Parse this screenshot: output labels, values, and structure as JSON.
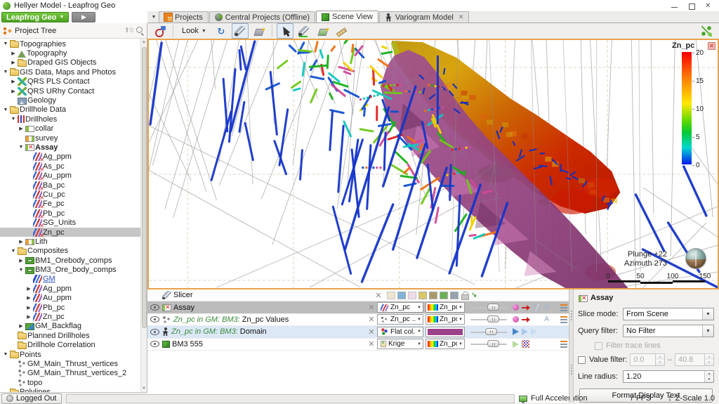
{
  "window": {
    "title": "Hellyer Model - Leapfrog Geo"
  },
  "app_menu": {
    "label": "Leapfrog Geo"
  },
  "tab_bar": {
    "tabs": [
      {
        "label": "Projects",
        "icon": "projects-icon",
        "active": false,
        "closable": false
      },
      {
        "label": "Central Projects (Offline)",
        "icon": "central-projects-icon",
        "active": false,
        "closable": false
      },
      {
        "label": "Scene View",
        "icon": "scene-cube-icon",
        "active": true,
        "closable": false
      },
      {
        "label": "Variogram Model",
        "icon": "variogram-person-icon",
        "active": false,
        "closable": true
      }
    ]
  },
  "project_tree": {
    "title": "Project Tree",
    "up_count": "0",
    "items": [
      {
        "label": "Topographies",
        "level": 0,
        "arrow": "down",
        "icon": "folder"
      },
      {
        "label": "Topography",
        "level": 1,
        "arrow": "right",
        "icon": "topo"
      },
      {
        "label": "Draped GIS Objects",
        "level": 1,
        "arrow": "right",
        "icon": "folder"
      },
      {
        "label": "GIS Data, Maps and Photos",
        "level": 0,
        "arrow": "down",
        "icon": "folder"
      },
      {
        "label": "QRS PLS Contact",
        "level": 1,
        "arrow": "right",
        "icon": "contact"
      },
      {
        "label": "QRS URhy Contact",
        "level": 1,
        "arrow": "right",
        "icon": "contact"
      },
      {
        "label": "Geology",
        "level": 1,
        "arrow": "none",
        "icon": "image"
      },
      {
        "label": "Drillhole Data",
        "level": 0,
        "arrow": "down",
        "icon": "folder"
      },
      {
        "label": "Drillholes",
        "level": 1,
        "arrow": "down",
        "icon": "drill"
      },
      {
        "label": "collar",
        "level": 2,
        "arrow": "right",
        "icon": "table-green"
      },
      {
        "label": "survey",
        "level": 2,
        "arrow": "none",
        "icon": "table-orange"
      },
      {
        "label": "Assay",
        "level": 2,
        "arrow": "down",
        "icon": "table-x",
        "bold": true
      },
      {
        "label": "Ag_ppm",
        "level": 3,
        "arrow": "none",
        "icon": "numeric"
      },
      {
        "label": "As_pc",
        "level": 3,
        "arrow": "none",
        "icon": "numeric"
      },
      {
        "label": "Au_ppm",
        "level": 3,
        "arrow": "none",
        "icon": "numeric"
      },
      {
        "label": "Ba_pc",
        "level": 3,
        "arrow": "none",
        "icon": "numeric"
      },
      {
        "label": "Cu_pc",
        "level": 3,
        "arrow": "none",
        "icon": "numeric"
      },
      {
        "label": "Fe_pc",
        "level": 3,
        "arrow": "none",
        "icon": "numeric"
      },
      {
        "label": "Pb_pc",
        "level": 3,
        "arrow": "none",
        "icon": "numeric"
      },
      {
        "label": "SG_Units",
        "level": 3,
        "arrow": "none",
        "icon": "numeric"
      },
      {
        "label": "Zn_pc",
        "level": 3,
        "arrow": "none",
        "icon": "numeric",
        "selected": true
      },
      {
        "label": "Lith",
        "level": 2,
        "arrow": "right",
        "icon": "table-orange"
      },
      {
        "label": "Composites",
        "level": 1,
        "arrow": "down",
        "icon": "folder"
      },
      {
        "label": "BM1_Orebody_comps",
        "level": 2,
        "arrow": "right",
        "icon": "comp"
      },
      {
        "label": "BM3_Ore_body_comps",
        "level": 2,
        "arrow": "down",
        "icon": "comp"
      },
      {
        "label": "GM",
        "level": 3,
        "arrow": "none",
        "icon": "gm",
        "link": true
      },
      {
        "label": "Ag_ppm",
        "level": 3,
        "arrow": "right",
        "icon": "numeric2"
      },
      {
        "label": "Au_ppm",
        "level": 3,
        "arrow": "right",
        "icon": "numeric2"
      },
      {
        "label": "Pb_pc",
        "level": 3,
        "arrow": "right",
        "icon": "numeric2"
      },
      {
        "label": "Zn_pc",
        "level": 3,
        "arrow": "right",
        "icon": "numeric2"
      },
      {
        "label": "GM_Backflag",
        "level": 2,
        "arrow": "right",
        "icon": "backflag"
      },
      {
        "label": "Planned Drillholes",
        "level": 1,
        "arrow": "none",
        "icon": "folder"
      },
      {
        "label": "Drillhole Correlation",
        "level": 1,
        "arrow": "none",
        "icon": "folder"
      },
      {
        "label": "Points",
        "level": 0,
        "arrow": "down",
        "icon": "folder"
      },
      {
        "label": "GM_Main_Thrust_vertices",
        "level": 1,
        "arrow": "none",
        "icon": "points"
      },
      {
        "label": "GM_Main_Thrust_vertices_2",
        "level": 1,
        "arrow": "none",
        "icon": "points"
      },
      {
        "label": "topo",
        "level": 1,
        "arrow": "none",
        "icon": "points"
      },
      {
        "label": "Polylines",
        "level": 0,
        "arrow": "none",
        "icon": "folder"
      }
    ]
  },
  "toolbar": {
    "look_label": "Look"
  },
  "scene": {
    "legend": {
      "title": "Zn_pc",
      "ticks": [
        "20",
        "15",
        "10",
        "5",
        "0"
      ],
      "top_color": "#f80000",
      "bottom_color": "#0018f0"
    },
    "orientation": {
      "plunge": "Plunge +22",
      "azimuth": "Azimuth 273"
    },
    "scale_bar": {
      "labels": [
        "0",
        "50",
        "100",
        "150"
      ]
    }
  },
  "shape_list": {
    "slicer_row": {
      "label": "Slicer"
    },
    "rows": [
      {
        "label": "Assay",
        "icon": "table-x",
        "selected": true,
        "highlight": false,
        "prefix": "",
        "dd1": {
          "icon": "numeric2",
          "label": "Zn_pc"
        },
        "dd2": {
          "type": "colormap",
          "label": "Zn_pc"
        },
        "slider": 72,
        "icons": [
          "sphere-magenta",
          "red-arrow",
          "trace-gray",
          "letter-a"
        ],
        "format_icon": true
      },
      {
        "label": "Zn_pc Values",
        "icon": "points",
        "selected": false,
        "highlight": false,
        "prefix": "Zn_pc in GM: BM3:",
        "dd1": {
          "icon": "points",
          "label": "Zn_pc ..."
        },
        "dd2": {
          "type": "colormap",
          "label": "Zn_pc"
        },
        "slider": 72,
        "icons": [
          "sphere-magenta",
          "red-arrow",
          "empty",
          "letter-a"
        ],
        "format_icon": true
      },
      {
        "label": "Domain",
        "icon": "person",
        "selected": false,
        "highlight": true,
        "prefix": "Zn_pc in GM: BM3:",
        "dd1": {
          "icon": "flat-colour",
          "label": "Flat col..."
        },
        "dd2": {
          "type": "swatch",
          "color": "#9c4189"
        },
        "slider": 62,
        "icons": [
          "cone-blue",
          "cone-light",
          "cone-light2"
        ],
        "format_icon": false
      },
      {
        "label": "BM3 555",
        "icon": "cube",
        "selected": false,
        "highlight": false,
        "prefix": "",
        "dd1": {
          "icon": "krige",
          "label": "Krige"
        },
        "dd2": {
          "type": "colormap",
          "label": "Zn_pc"
        },
        "slider": 72,
        "icons": [
          "cone-green",
          "grid-dots"
        ],
        "format_icon": true
      }
    ]
  },
  "properties": {
    "title": "Assay",
    "slice_mode_label": "Slice mode:",
    "slice_mode": "From Scene",
    "query_filter_label": "Query filter:",
    "query_filter": "No Filter",
    "filter_trace_label": "Filter trace lines",
    "value_filter_label": "Value filter:",
    "value_min": "0.0",
    "value_max": "40.8",
    "line_radius_label": "Line radius:",
    "line_radius": "1.20",
    "format_button": "Format Display Text"
  },
  "status_bar": {
    "logged_out": "Logged Out",
    "acceleration": "Full Acceleration",
    "fps": "7 FPS",
    "z_scale": "Z-Scale 1.0"
  }
}
